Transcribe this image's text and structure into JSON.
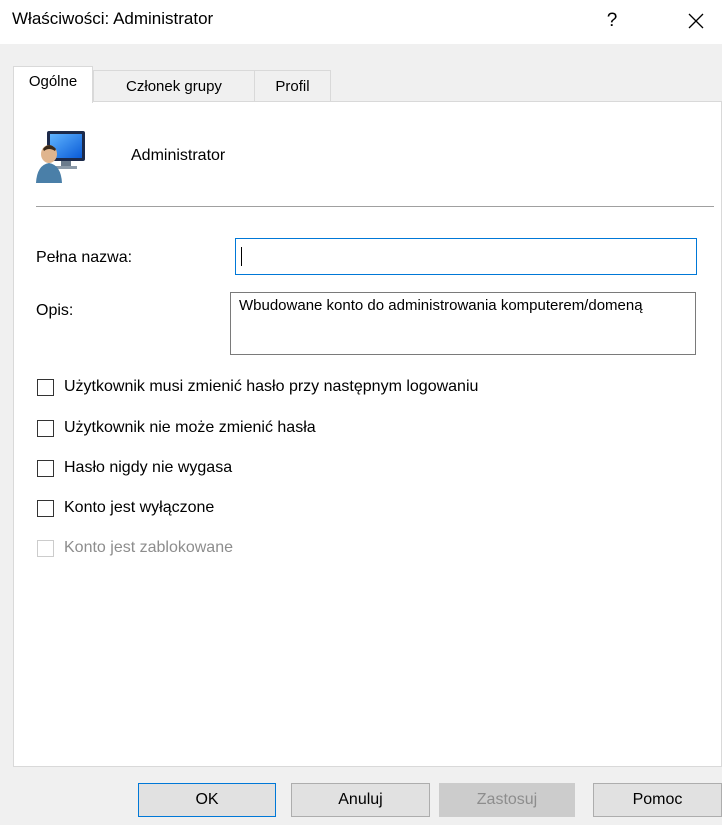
{
  "window": {
    "title": "Właściwości: Administrator",
    "help_glyph": "?",
    "close_icon": "close-icon"
  },
  "tabs": [
    {
      "label": "Ogólne",
      "active": true
    },
    {
      "label": "Członek grupy",
      "active": false
    },
    {
      "label": "Profil",
      "active": false
    }
  ],
  "general": {
    "user_icon": "user-monitor-icon",
    "username": "Administrator",
    "full_name": {
      "label": "Pełna nazwa:",
      "value": ""
    },
    "description": {
      "label": "Opis:",
      "value": "Wbudowane konto do administrowania komputerem/domeną"
    },
    "checkboxes": [
      {
        "label": "Użytkownik musi zmienić hasło przy następnym logowaniu",
        "checked": false,
        "enabled": true
      },
      {
        "label": "Użytkownik nie może zmienić hasła",
        "checked": false,
        "enabled": true
      },
      {
        "label": "Hasło nigdy nie wygasa",
        "checked": false,
        "enabled": true
      },
      {
        "label": "Konto jest wyłączone",
        "checked": false,
        "enabled": true
      },
      {
        "label": "Konto jest zablokowane",
        "checked": false,
        "enabled": false
      }
    ]
  },
  "buttons": {
    "ok": "OK",
    "cancel": "Anuluj",
    "apply": "Zastosuj",
    "help": "Pomoc"
  },
  "colors": {
    "focus_border": "#0078d7",
    "dialog_bg": "#f0f0f0",
    "disabled_text": "#8d8d8d"
  }
}
